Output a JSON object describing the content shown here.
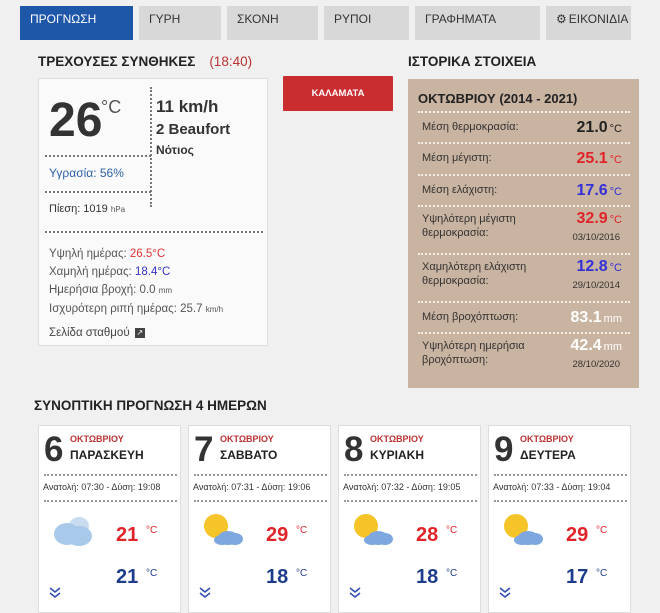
{
  "tabs": [
    {
      "label": "ΠΡΟΓΝΩΣΗ",
      "active": true
    },
    {
      "label": "ΓΥΡΗ"
    },
    {
      "label": "ΣΚΟΝΗ"
    },
    {
      "label": "ΡΥΠΟΙ"
    },
    {
      "label": "ΓΡΑΦΗΜΑΤΑ"
    },
    {
      "label": "ΕΙΚΟΝΙΔΙΑ",
      "icon": "gear-icon"
    }
  ],
  "current": {
    "title": "ΤΡΕΧΟΥΣΕΣ ΣΥΝΘΗΚΕΣ",
    "time": "(18:40)",
    "temperature": "26",
    "temp_unit": "°C",
    "wind_speed": "11 km/h",
    "wind_beaufort": "2 Beaufort",
    "wind_direction": "Νότιος",
    "humidity": "Υγρασία: 56%",
    "pressure_label": "Πίεση: 1019",
    "pressure_unit": "hPa",
    "high_label": "Υψηλή ημέρας:",
    "high_value": "26.5°C",
    "low_label": "Χαμηλή ημέρας:",
    "low_value": "18.4°C",
    "rain_label": "Ημερήσια βροχή: 0.0",
    "rain_unit": "mm",
    "gust_label": "Ισχυρότερη ριπή ημέρας: 25.7",
    "gust_unit": "km/h",
    "station_link": "Σελίδα σταθμού"
  },
  "station_button": "ΚΑΛΑΜΑΤΑ",
  "history": {
    "section_title": "ΙΣΤΟΡΙΚΑ ΣΤΟΙΧΕΙΑ",
    "title": "ΟΚΤΩΒΡΙΟΥ (2014 - 2021)",
    "rows": [
      {
        "label": "Μέση θερμοκρασία:",
        "value": "21.0",
        "unit": "°C",
        "color": "#222222"
      },
      {
        "label": "Μέση μέγιστη:",
        "value": "25.1",
        "unit": "°C",
        "color": "#e0242a"
      },
      {
        "label": "Μέση ελάχιστη:",
        "value": "17.6",
        "unit": "°C",
        "color": "#3330d8"
      },
      {
        "label": "Υψηλότερη μέγιστη θερμοκρασία:",
        "value": "32.9",
        "unit": "°C",
        "date": "03/10/2016",
        "color": "#e0242a"
      },
      {
        "label": "Χαμηλότερη ελάχιστη θερμοκρασία:",
        "value": "12.8",
        "unit": "°C",
        "date": "29/10/2014",
        "color": "#3330d8"
      },
      {
        "label": "Μέση βροχόπτωση:",
        "value": "83.1",
        "unit": "mm",
        "color": "#ffffff"
      },
      {
        "label": "Υψηλότερη ημερήσια βροχόπτωση:",
        "value": "42.4",
        "unit": "mm",
        "date": "28/10/2020",
        "color": "#ffffff"
      }
    ]
  },
  "forecast": {
    "title": "ΣΥΝΟΠΤΙΚΗ ΠΡΟΓΝΩΣΗ 4 ΗΜΕΡΩΝ",
    "days": [
      {
        "day": "6",
        "month": "ΟΚΤΩΒΡΙΟΥ",
        "weekday": "ΠΑΡΑΣΚΕΥΗ",
        "sun": "Ανατολή: 07:30 - Δύση: 19:08",
        "icon": "cloud-icon",
        "max": "21",
        "min": "21",
        "unit": "°C"
      },
      {
        "day": "7",
        "month": "ΟΚΤΩΒΡΙΟΥ",
        "weekday": "ΣΑΒΒΑΤΟ",
        "sun": "Ανατολή: 07:31 - Δύση: 19:06",
        "icon": "partly-cloudy-icon",
        "max": "29",
        "min": "18",
        "unit": "°C"
      },
      {
        "day": "8",
        "month": "ΟΚΤΩΒΡΙΟΥ",
        "weekday": "ΚΥΡΙΑΚΗ",
        "sun": "Ανατολή: 07:32 - Δύση: 19:05",
        "icon": "partly-cloudy-icon",
        "max": "28",
        "min": "18",
        "unit": "°C"
      },
      {
        "day": "9",
        "month": "ΟΚΤΩΒΡΙΟΥ",
        "weekday": "ΔΕΥΤΕΡΑ",
        "sun": "Ανατολή: 07:33 - Δύση: 19:04",
        "icon": "partly-cloudy-icon",
        "max": "29",
        "min": "17",
        "unit": "°C"
      }
    ]
  }
}
